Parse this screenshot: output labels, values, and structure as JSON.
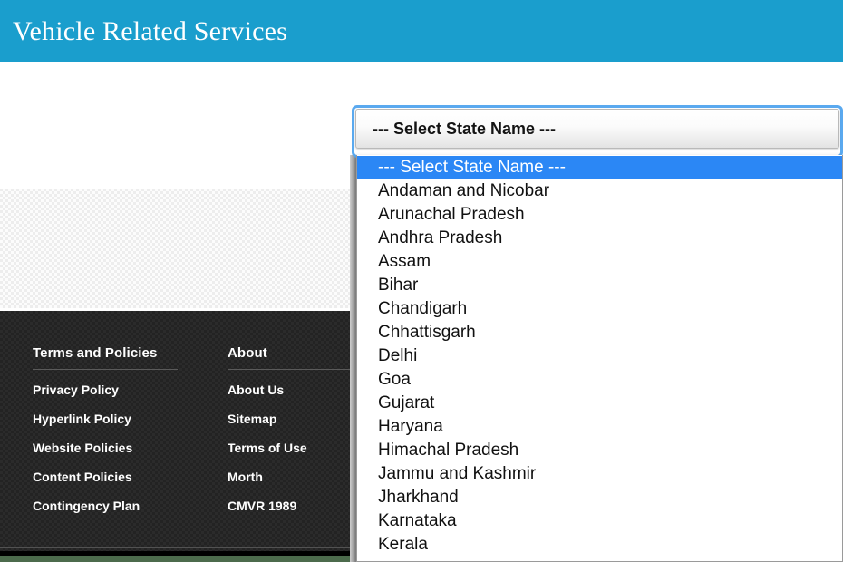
{
  "header": {
    "title": "Vehicle Related Services",
    "bg_color": "#1a9ecd"
  },
  "select": {
    "name": "state-name-select",
    "selected_value": "--- Select State Name ---",
    "focus_ring_color": "#5aa9ef",
    "expanded": true,
    "highlight_color": "#2b87f5",
    "options": [
      "--- Select State Name ---",
      "Andaman and Nicobar",
      "Arunachal Pradesh",
      "Andhra Pradesh",
      "Assam",
      "Bihar",
      "Chandigarh",
      "Chhattisgarh",
      "Delhi",
      "Goa",
      "Gujarat",
      "Haryana",
      "Himachal Pradesh",
      "Jammu and Kashmir",
      "Jharkhand",
      "Karnataka",
      "Kerala"
    ],
    "highlighted_index": 0
  },
  "footer": {
    "bg_color": "#232323",
    "columns": [
      {
        "heading": "Terms and Policies",
        "links": [
          "Privacy Policy",
          "Hyperlink Policy",
          "Website Policies",
          "Content Policies",
          "Contingency Plan"
        ]
      },
      {
        "heading": "About",
        "links": [
          "About Us",
          "Sitemap",
          "Terms of Use",
          "Morth",
          "CMVR 1989"
        ]
      }
    ]
  },
  "bottom_bar": {
    "color": "#4c6b4c"
  }
}
